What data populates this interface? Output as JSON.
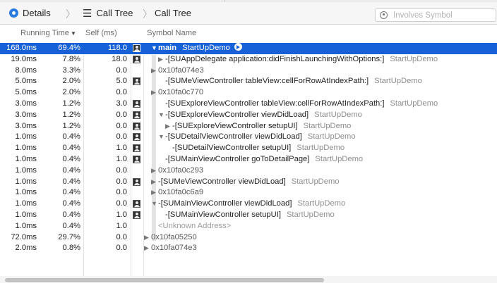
{
  "nav": {
    "details_label": "Details",
    "call_tree_label": "Call Tree",
    "crumb_label": "Call Tree",
    "search_placeholder": "Involves Symbol"
  },
  "columns": {
    "running_time": "Running Time",
    "self": "Self (ms)",
    "symbol": "Symbol Name"
  },
  "rows": [
    {
      "ms": "168.0ms",
      "pct": "69.4%",
      "self": "118.0",
      "user_icon": true,
      "indent": 0,
      "disc": "▼",
      "sym": "main",
      "lib": "StartUpDemo",
      "kind": "selected"
    },
    {
      "ms": "19.0ms",
      "pct": "7.8%",
      "self": "18.0",
      "user_icon": true,
      "indent": 1,
      "disc": "▶",
      "sym": "-[SUAppDelegate application:didFinishLaunchingWithOptions:]",
      "lib": "StartUpDemo",
      "kind": "sym"
    },
    {
      "ms": "8.0ms",
      "pct": "3.3%",
      "self": "0.0",
      "user_icon": false,
      "indent": 0,
      "disc": "▶",
      "sym": "0x10fa074e3",
      "lib": "",
      "kind": "addr"
    },
    {
      "ms": "5.0ms",
      "pct": "2.0%",
      "self": "5.0",
      "user_icon": true,
      "indent": 1,
      "disc": "",
      "sym": "-[SUMeViewController tableView:cellForRowAtIndexPath:]",
      "lib": "StartUpDemo",
      "kind": "sym"
    },
    {
      "ms": "5.0ms",
      "pct": "2.0%",
      "self": "0.0",
      "user_icon": false,
      "indent": 0,
      "disc": "▶",
      "sym": "0x10fa0c770",
      "lib": "",
      "kind": "addr"
    },
    {
      "ms": "3.0ms",
      "pct": "1.2%",
      "self": "3.0",
      "user_icon": true,
      "indent": 1,
      "disc": "",
      "sym": "-[SUExploreViewController tableView:cellForRowAtIndexPath:]",
      "lib": "StartUpDemo",
      "kind": "sym"
    },
    {
      "ms": "3.0ms",
      "pct": "1.2%",
      "self": "0.0",
      "user_icon": true,
      "indent": 1,
      "disc": "▼",
      "sym": "-[SUExploreViewController viewDidLoad]",
      "lib": "StartUpDemo",
      "kind": "sym"
    },
    {
      "ms": "3.0ms",
      "pct": "1.2%",
      "self": "0.0",
      "user_icon": true,
      "indent": 2,
      "disc": "▶",
      "sym": "-[SUExploreViewController setupUI]",
      "lib": "StartUpDemo",
      "kind": "sym"
    },
    {
      "ms": "1.0ms",
      "pct": "0.4%",
      "self": "0.0",
      "user_icon": true,
      "indent": 1,
      "disc": "▼",
      "sym": "-[SUDetailViewController viewDidLoad]",
      "lib": "StartUpDemo",
      "kind": "sym"
    },
    {
      "ms": "1.0ms",
      "pct": "0.4%",
      "self": "1.0",
      "user_icon": true,
      "indent": 2,
      "disc": "",
      "sym": "-[SUDetailViewController setupUI]",
      "lib": "StartUpDemo",
      "kind": "sym"
    },
    {
      "ms": "1.0ms",
      "pct": "0.4%",
      "self": "1.0",
      "user_icon": true,
      "indent": 1,
      "disc": "",
      "sym": "-[SUMainViewController goToDetailPage]",
      "lib": "StartUpDemo",
      "kind": "sym"
    },
    {
      "ms": "1.0ms",
      "pct": "0.4%",
      "self": "0.0",
      "user_icon": false,
      "indent": 0,
      "disc": "▶",
      "sym": "0x10fa0c293",
      "lib": "",
      "kind": "addr"
    },
    {
      "ms": "1.0ms",
      "pct": "0.4%",
      "self": "0.0",
      "user_icon": true,
      "indent": 0,
      "disc": "▶",
      "sym": "-[SUMeViewController viewDidLoad]",
      "lib": "StartUpDemo",
      "kind": "sym"
    },
    {
      "ms": "1.0ms",
      "pct": "0.4%",
      "self": "0.0",
      "user_icon": false,
      "indent": 0,
      "disc": "▶",
      "sym": "0x10fa0c6a9",
      "lib": "",
      "kind": "addr"
    },
    {
      "ms": "1.0ms",
      "pct": "0.4%",
      "self": "0.0",
      "user_icon": true,
      "indent": 0,
      "disc": "▼",
      "sym": "-[SUMainViewController viewDidLoad]",
      "lib": "StartUpDemo",
      "kind": "sym"
    },
    {
      "ms": "1.0ms",
      "pct": "0.4%",
      "self": "1.0",
      "user_icon": true,
      "indent": 1,
      "disc": "",
      "sym": "-[SUMainViewController setupUI]",
      "lib": "StartUpDemo",
      "kind": "sym"
    },
    {
      "ms": "1.0ms",
      "pct": "0.4%",
      "self": "1.0",
      "user_icon": false,
      "indent": 0,
      "disc": "",
      "sym": "<Unknown Address>",
      "lib": "",
      "kind": "unknown"
    },
    {
      "ms": "72.0ms",
      "pct": "29.7%",
      "self": "0.0",
      "user_icon": false,
      "indent": -1,
      "disc": "▶",
      "sym": "0x10fa05250",
      "lib": "",
      "kind": "addr"
    },
    {
      "ms": "2.0ms",
      "pct": "0.8%",
      "self": "0.0",
      "user_icon": false,
      "indent": -1,
      "disc": "▶",
      "sym": "0x10fa074e3",
      "lib": "",
      "kind": "addr"
    }
  ]
}
